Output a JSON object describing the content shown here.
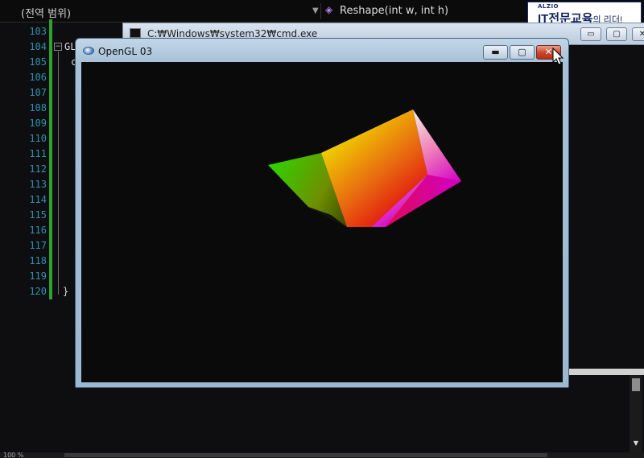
{
  "ide": {
    "scope_dropdown": "(전역 범위)",
    "member_dropdown": "Reshape(int w, int h)",
    "line_numbers": [
      "103",
      "104",
      "105",
      "106",
      "107",
      "108",
      "109",
      "110",
      "111",
      "112",
      "113",
      "114",
      "115",
      "116",
      "117",
      "118",
      "119",
      "120"
    ],
    "code_fragment_104": "GL",
    "code_fragment_105": "c",
    "code_fragment_120": "}",
    "zoom_label": "100 %"
  },
  "ad": {
    "small_text": "ALZIO",
    "main_text": "IT전문교육",
    "tail_text": "의 리더!"
  },
  "cmd_window": {
    "title": "C:₩Windows₩system32₩cmd.exe",
    "minimize": "▭",
    "maximize": "▢",
    "close": "✕"
  },
  "gl_window": {
    "title": "OpenGL 03",
    "minimize": "▬",
    "maximize": "▢",
    "close": "✕"
  },
  "colors": {
    "line_number": "#2b91af",
    "change_bar": "#2ea02e",
    "close_button": "#c8452a"
  }
}
